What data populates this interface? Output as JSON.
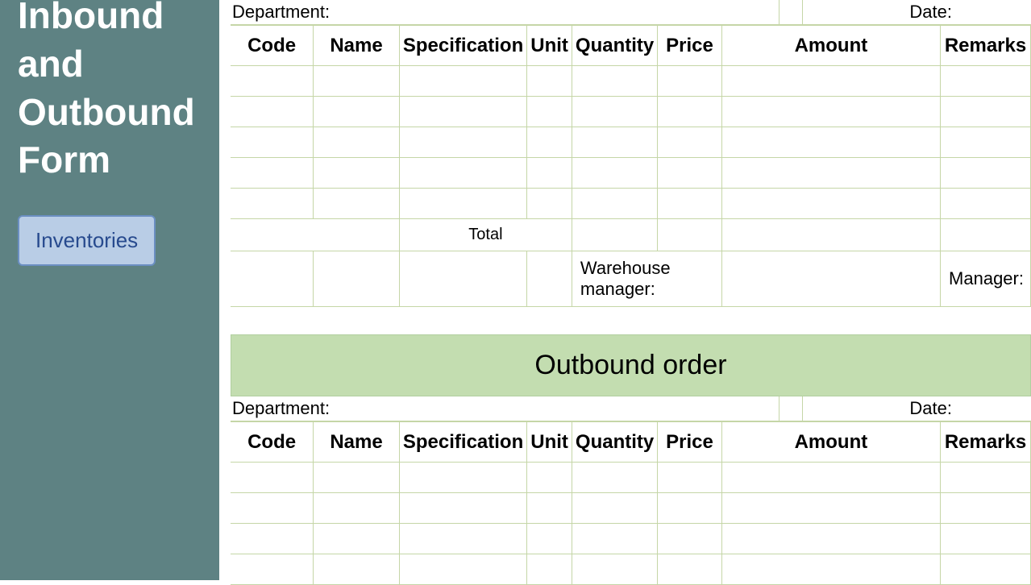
{
  "sidebar": {
    "title": "Inbound and Outbound Form",
    "button": "Inventories"
  },
  "inbound": {
    "department_label": "Department:",
    "date_label": "Date:",
    "headers": {
      "code": "Code",
      "name": "Name",
      "spec": "Specification",
      "unit": "Unit",
      "qty": "Quantity",
      "price": "Price",
      "amount": "Amount",
      "remarks": "Remarks"
    },
    "total_label": "Total",
    "warehouse_mgr": "Warehouse manager:",
    "manager": "Manager:"
  },
  "outbound": {
    "title": "Outbound order",
    "department_label": "Department:",
    "date_label": "Date:",
    "headers": {
      "code": "Code",
      "name": "Name",
      "spec": "Specification",
      "unit": "Unit",
      "qty": "Quantity",
      "price": "Price",
      "amount": "Amount",
      "remarks": "Remarks"
    }
  }
}
